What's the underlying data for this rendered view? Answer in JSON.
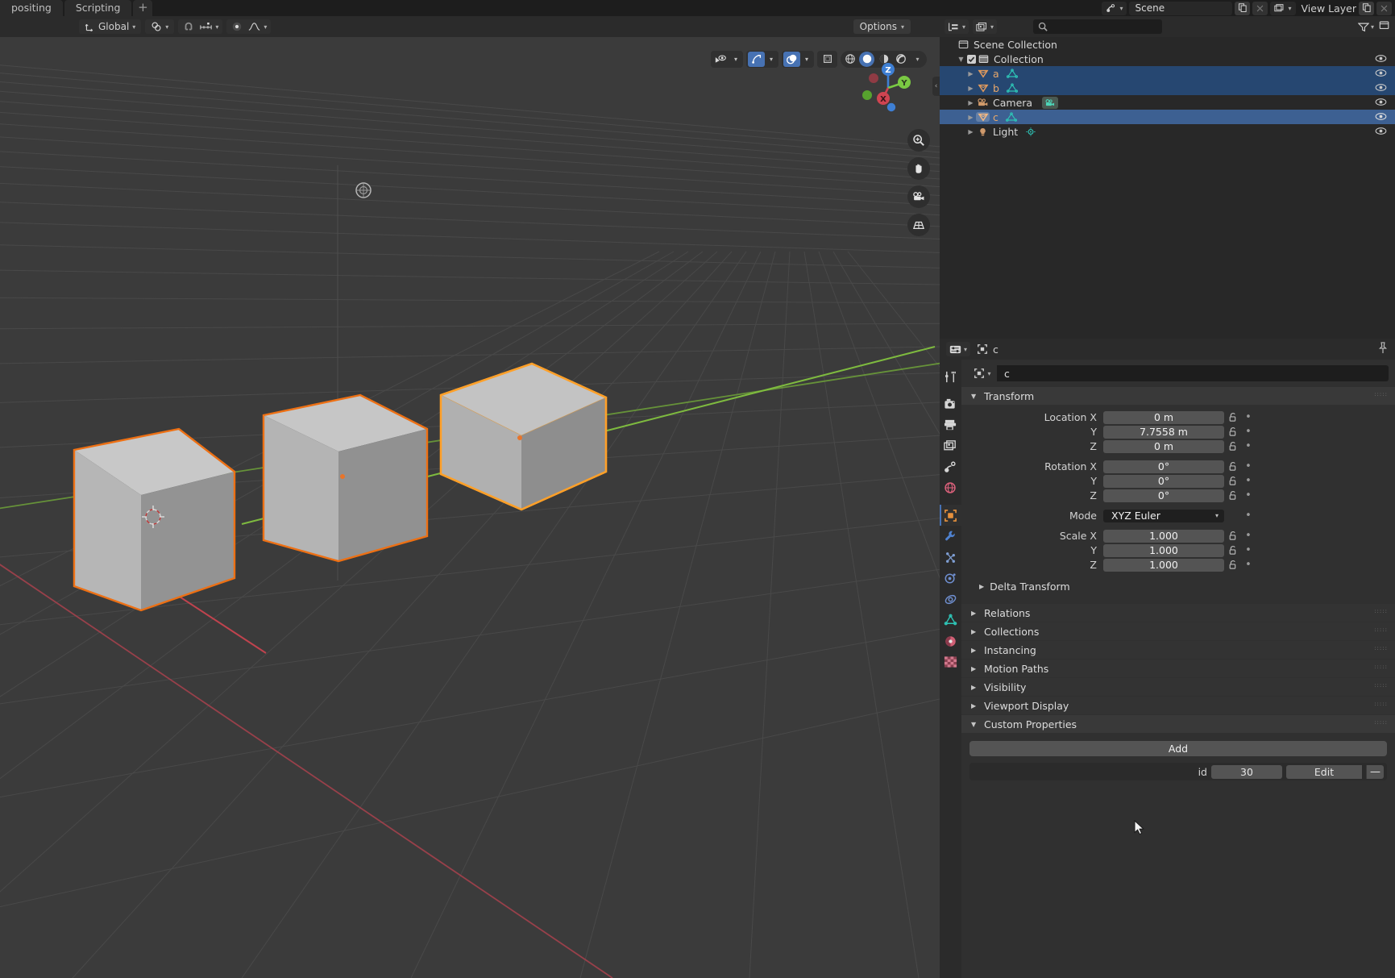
{
  "topbar": {
    "workspace_tabs": [
      "positing",
      "Scripting"
    ],
    "add_workspace": "+",
    "scene_label": "Scene",
    "view_layer_label": "View Layer",
    "icons": [
      "blender-scene-icon",
      "copy-icon",
      "close-icon",
      "view-layer-icon",
      "dropdown-caret",
      "filter-icon",
      "new-viewlayer-icon",
      "remove-viewlayer-icon"
    ]
  },
  "viewport": {
    "header": {
      "orientation": "Global",
      "snap_label": "",
      "options_label": "Options",
      "icons": [
        "transform-orientation-icon",
        "snap-magnet-icon",
        "snap-increment-icon",
        "proportional-edit-icon",
        "falloff-curve-icon"
      ]
    },
    "overlay_buttons": [
      "visibility-eye-icon",
      "gizmo-icon",
      "overlays-icon",
      "xray-icon"
    ],
    "shading_modes": [
      "wireframe",
      "solid",
      "material-preview",
      "rendered"
    ],
    "active_shading": "solid",
    "gizmo_axes": [
      "Z",
      "Y",
      "X"
    ],
    "nav_buttons": [
      "zoom-icon",
      "pan-hand-icon",
      "camera-view-icon",
      "ortho-persp-icon"
    ]
  },
  "outliner": {
    "header": {
      "display_mode": "view-layer-icon",
      "filter_icon": "filter-icon",
      "search_placeholder": ""
    },
    "rows": [
      {
        "name": "Scene Collection",
        "type": "scene-collection",
        "indent": 0,
        "state": "none",
        "expand": "",
        "checkbox": false,
        "eye": false,
        "datablock": ""
      },
      {
        "name": "Collection",
        "type": "collection",
        "indent": 1,
        "state": "none",
        "expand": "open",
        "checkbox": true,
        "eye": true,
        "datablock": ""
      },
      {
        "name": "a",
        "type": "mesh-object",
        "indent": 2,
        "state": "selected",
        "expand": "closed",
        "checkbox": false,
        "eye": true,
        "datablock": "mesh-data-icon"
      },
      {
        "name": "b",
        "type": "mesh-object",
        "indent": 2,
        "state": "selected",
        "expand": "closed",
        "checkbox": false,
        "eye": true,
        "datablock": "mesh-data-icon"
      },
      {
        "name": "Camera",
        "type": "camera-object",
        "indent": 2,
        "state": "none",
        "expand": "closed",
        "checkbox": false,
        "eye": true,
        "datablock": "camera-data-icon"
      },
      {
        "name": "c",
        "type": "mesh-object",
        "indent": 2,
        "state": "active",
        "expand": "closed",
        "checkbox": false,
        "eye": true,
        "datablock": "mesh-data-icon"
      },
      {
        "name": "Light",
        "type": "light-object",
        "indent": 2,
        "state": "none",
        "expand": "closed",
        "checkbox": false,
        "eye": true,
        "datablock": "light-data-icon"
      }
    ]
  },
  "properties": {
    "breadcrumb_object": "c",
    "id_name": "c",
    "pin_icon": "pin-icon",
    "tabs": [
      "tool-icon",
      "render-icon",
      "output-icon",
      "view-layer-icon",
      "scene-icon",
      "world-icon",
      "object-icon",
      "modifier-icon",
      "particles-icon",
      "physics-icon",
      "constraints-icon",
      "data-icon",
      "material-icon",
      "texture-icon"
    ],
    "active_tab": "object-icon",
    "transform": {
      "title": "Transform",
      "location": {
        "label": "Location X",
        "sub": [
          "Y",
          "Z"
        ],
        "values": [
          "0 m",
          "7.7558 m",
          "0 m"
        ]
      },
      "rotation": {
        "label": "Rotation X",
        "sub": [
          "Y",
          "Z"
        ],
        "values": [
          "0°",
          "0°",
          "0°"
        ]
      },
      "mode": {
        "label": "Mode",
        "value": "XYZ Euler"
      },
      "scale": {
        "label": "Scale X",
        "sub": [
          "Y",
          "Z"
        ],
        "values": [
          "1.000",
          "1.000",
          "1.000"
        ]
      }
    },
    "sections": [
      {
        "label": "Delta Transform",
        "open": false,
        "sub": true
      },
      {
        "label": "Relations",
        "open": false,
        "sub": false
      },
      {
        "label": "Collections",
        "open": false,
        "sub": false
      },
      {
        "label": "Instancing",
        "open": false,
        "sub": false
      },
      {
        "label": "Motion Paths",
        "open": false,
        "sub": false
      },
      {
        "label": "Visibility",
        "open": false,
        "sub": false
      },
      {
        "label": "Viewport Display",
        "open": false,
        "sub": false
      }
    ],
    "custom_properties": {
      "title": "Custom Properties",
      "add_label": "Add",
      "entries": [
        {
          "key": "id",
          "value": "30",
          "edit_label": "Edit",
          "delete_label": "—"
        }
      ]
    }
  },
  "colors": {
    "accent_blue": "#4772b3",
    "selected_outline": "#ed7014",
    "active_outline": "#ffa028",
    "object_text": "#e8a86b",
    "mesh_data": "#2ec4b6",
    "axis_x": "#cf4451",
    "axis_y": "#7ac943",
    "axis_z": "#3e7fd4"
  }
}
